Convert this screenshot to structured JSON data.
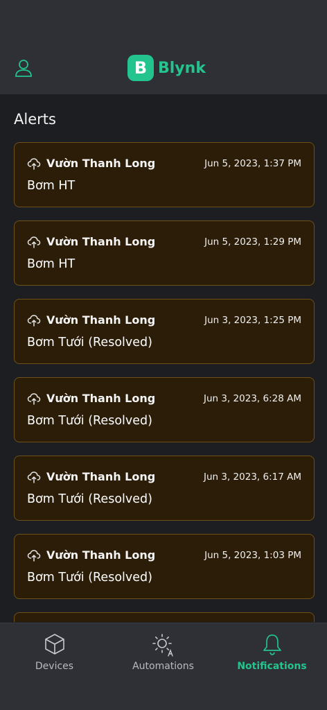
{
  "header": {
    "brand_letter": "B",
    "brand_name": "Blynk"
  },
  "alerts_title": "Alerts",
  "alerts": [
    {
      "device": "Vườn Thanh Long",
      "time": "Jun 5, 2023, 1:37 PM",
      "event": "Bơm HT"
    },
    {
      "device": "Vườn Thanh Long",
      "time": "Jun 5, 2023, 1:29 PM",
      "event": "Bơm HT"
    },
    {
      "device": "Vườn Thanh Long",
      "time": "Jun 3, 2023, 1:25 PM",
      "event": "Bơm Tưới (Resolved)"
    },
    {
      "device": "Vườn Thanh Long",
      "time": "Jun 3, 2023, 6:28 AM",
      "event": "Bơm Tưới (Resolved)"
    },
    {
      "device": "Vườn Thanh Long",
      "time": "Jun 3, 2023, 6:17 AM",
      "event": "Bơm Tưới (Resolved)"
    },
    {
      "device": "Vườn Thanh Long",
      "time": "Jun 5, 2023, 1:03 PM",
      "event": "Bơm Tưới (Resolved)"
    }
  ],
  "tabs": [
    {
      "label": "Devices",
      "icon": "cube-icon",
      "active": false
    },
    {
      "label": "Automations",
      "icon": "sun-automation-icon",
      "active": false
    },
    {
      "label": "Notifications",
      "icon": "bell-icon",
      "active": true
    }
  ],
  "colors": {
    "accent": "#23c48e",
    "background": "#1d1e22",
    "bar": "#2f3035",
    "card_bg": "#2c1d09",
    "card_border": "#6e5117"
  }
}
